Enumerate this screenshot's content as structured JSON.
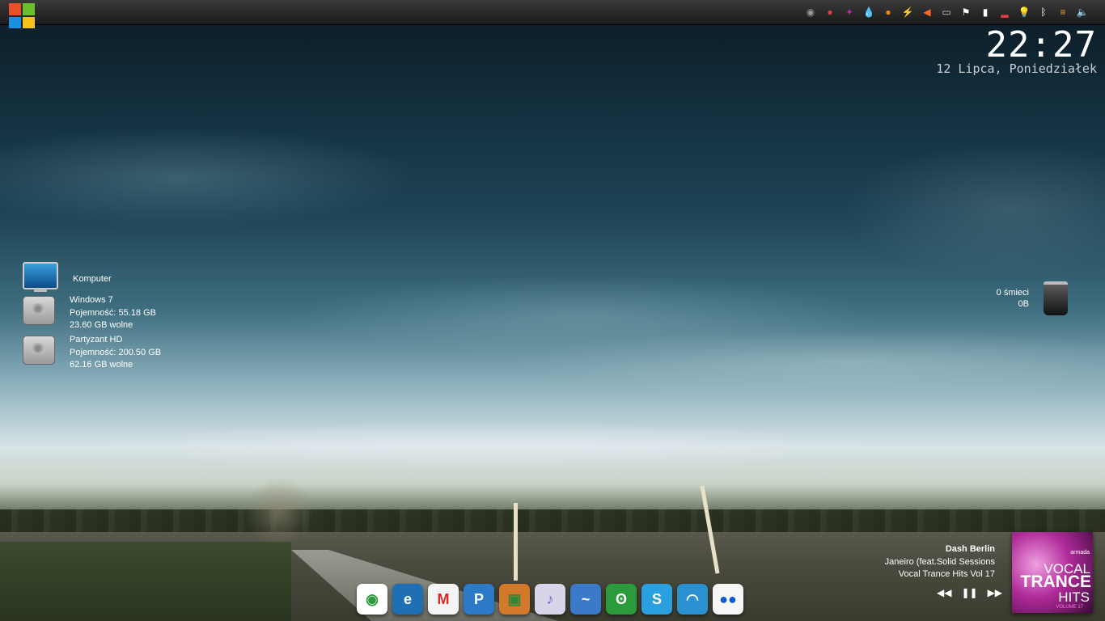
{
  "taskbar": {
    "tray_icons": [
      {
        "name": "camera-icon",
        "glyph": "◉",
        "color": "#9a9a9a"
      },
      {
        "name": "opera-icon",
        "glyph": "●",
        "color": "#e83a4a"
      },
      {
        "name": "purple-app-icon",
        "glyph": "✦",
        "color": "#b02aa8"
      },
      {
        "name": "drop-icon",
        "glyph": "💧",
        "color": "#5ab0ff"
      },
      {
        "name": "orange-app-icon",
        "glyph": "●",
        "color": "#f08a1a"
      },
      {
        "name": "lightning-icon",
        "glyph": "⚡",
        "color": "#f0a020"
      },
      {
        "name": "speaker-icon",
        "glyph": "◀",
        "color": "#ff6a2a"
      },
      {
        "name": "monitor-icon",
        "glyph": "▭",
        "color": "#cccccc"
      },
      {
        "name": "flag-icon",
        "glyph": "⚑",
        "color": "#ffffff"
      },
      {
        "name": "battery-icon",
        "glyph": "▮",
        "color": "#ffffff"
      },
      {
        "name": "signal-icon",
        "glyph": "▂",
        "color": "#e04040"
      },
      {
        "name": "bulb-icon",
        "glyph": "💡",
        "color": "#ffe060"
      },
      {
        "name": "bluetooth-icon",
        "glyph": "ᛒ",
        "color": "#ffffff"
      },
      {
        "name": "menu-icon",
        "glyph": "≡",
        "color": "#f0a020"
      },
      {
        "name": "volume-icon",
        "glyph": "🔈",
        "color": "#ffffff"
      }
    ]
  },
  "clock": {
    "time": "22:27",
    "date": "12 Lipca, Poniedziałek"
  },
  "desktop": {
    "computer": {
      "label": "Komputer"
    },
    "drives": [
      {
        "name": "Windows 7",
        "capacity": "Pojemność: 55.18 GB",
        "free": "23.60 GB wolne"
      },
      {
        "name": "Partyzant HD",
        "capacity": "Pojemność: 200.50 GB",
        "free": "62.16 GB wolne"
      }
    ],
    "trash": {
      "count": "0 śmieci",
      "size": "0B"
    }
  },
  "dock": {
    "apps": [
      {
        "name": "chrome-icon",
        "glyph": "◉",
        "bg": "#ffffff",
        "fg": "#2a9a3a"
      },
      {
        "name": "internet-explorer-icon",
        "glyph": "e",
        "bg": "#1f6fb5",
        "fg": "#ffffff"
      },
      {
        "name": "gmail-icon",
        "glyph": "M",
        "bg": "#f4f4f4",
        "fg": "#d42a2a"
      },
      {
        "name": "pandora-icon",
        "glyph": "P",
        "bg": "#2a7ac8",
        "fg": "#ffffff"
      },
      {
        "name": "game-icon",
        "glyph": "▣",
        "bg": "#d4782a",
        "fg": "#2a8a3a"
      },
      {
        "name": "itunes-icon",
        "glyph": "♪",
        "bg": "#d8d4ea",
        "fg": "#7a5ac8"
      },
      {
        "name": "openoffice-icon",
        "glyph": "~",
        "bg": "#3a7ac8",
        "fg": "#ffffff"
      },
      {
        "name": "bittorrent-icon",
        "glyph": "ʘ",
        "bg": "#2a9a3a",
        "fg": "#ffffff"
      },
      {
        "name": "skype-icon",
        "glyph": "S",
        "bg": "#2aa0e0",
        "fg": "#ffffff"
      },
      {
        "name": "wifi-icon",
        "glyph": "◠",
        "bg": "#2a90d0",
        "fg": "#ffffff"
      },
      {
        "name": "flickr-icon",
        "glyph": "●●",
        "bg": "#f6f6f6",
        "fg": "#0a5ad4"
      }
    ]
  },
  "now_playing": {
    "artist": "Dash Berlin",
    "track": "Janeiro (feat.Solid Sessions",
    "album": "Vocal Trance Hits Vol 17",
    "album_art": {
      "l1": "armada",
      "l2": "VOCAL",
      "l3": "TRANCE",
      "l4": "HITS",
      "l5": "VOLUME 17"
    },
    "controls": {
      "prev": "◀◀",
      "pause": "❚❚",
      "next": "▶▶"
    }
  }
}
